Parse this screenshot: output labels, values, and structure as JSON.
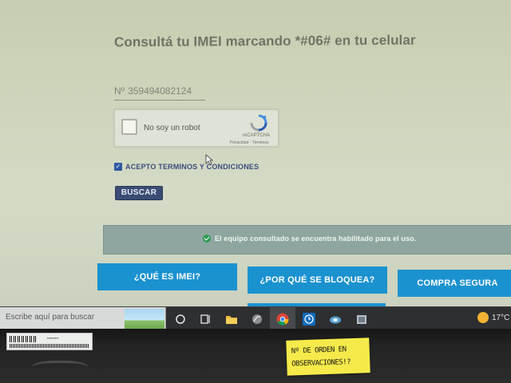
{
  "page": {
    "title": "Consultá tu IMEI marcando *#06# en tu celular"
  },
  "imei_input": {
    "prefix": "Nº",
    "value": "359494082124"
  },
  "recaptcha": {
    "label": "No soy un robot",
    "brand": "reCAPTCHA",
    "links": "Privacidad - Términos"
  },
  "terms": {
    "checked": true,
    "label": "ACEPTO TERMINOS Y CONDICIONES"
  },
  "search_button": {
    "label": "BUSCAR"
  },
  "result": {
    "message": "El equipo consultado se encuentra habilitado para el uso.",
    "status_color": "#2e9b52"
  },
  "nav": {
    "what_is_imei": "¿QUÉ ES IMEI?",
    "why_blocked": "¿POR QUÉ SE BLOQUEA?",
    "secure_purchase": "COMPRA SEGURA"
  },
  "taskbar": {
    "search_placeholder": "Escribe aquí para buscar",
    "temperature": "17°C",
    "icons": [
      "task-view-icon",
      "multitasking-icon",
      "file-explorer-icon",
      "app-icon",
      "chrome-icon",
      "clock-app-icon",
      "cloud-app-icon",
      "store-app-icon"
    ]
  },
  "sticky_note": {
    "line1": "Nº DE ORDEN EN",
    "line2": "OBSERVACIONES!?"
  },
  "colors": {
    "accent_blue": "#1b92d0",
    "button_dark": "#3b4c74",
    "alert_bg": "#8fa6a0"
  }
}
